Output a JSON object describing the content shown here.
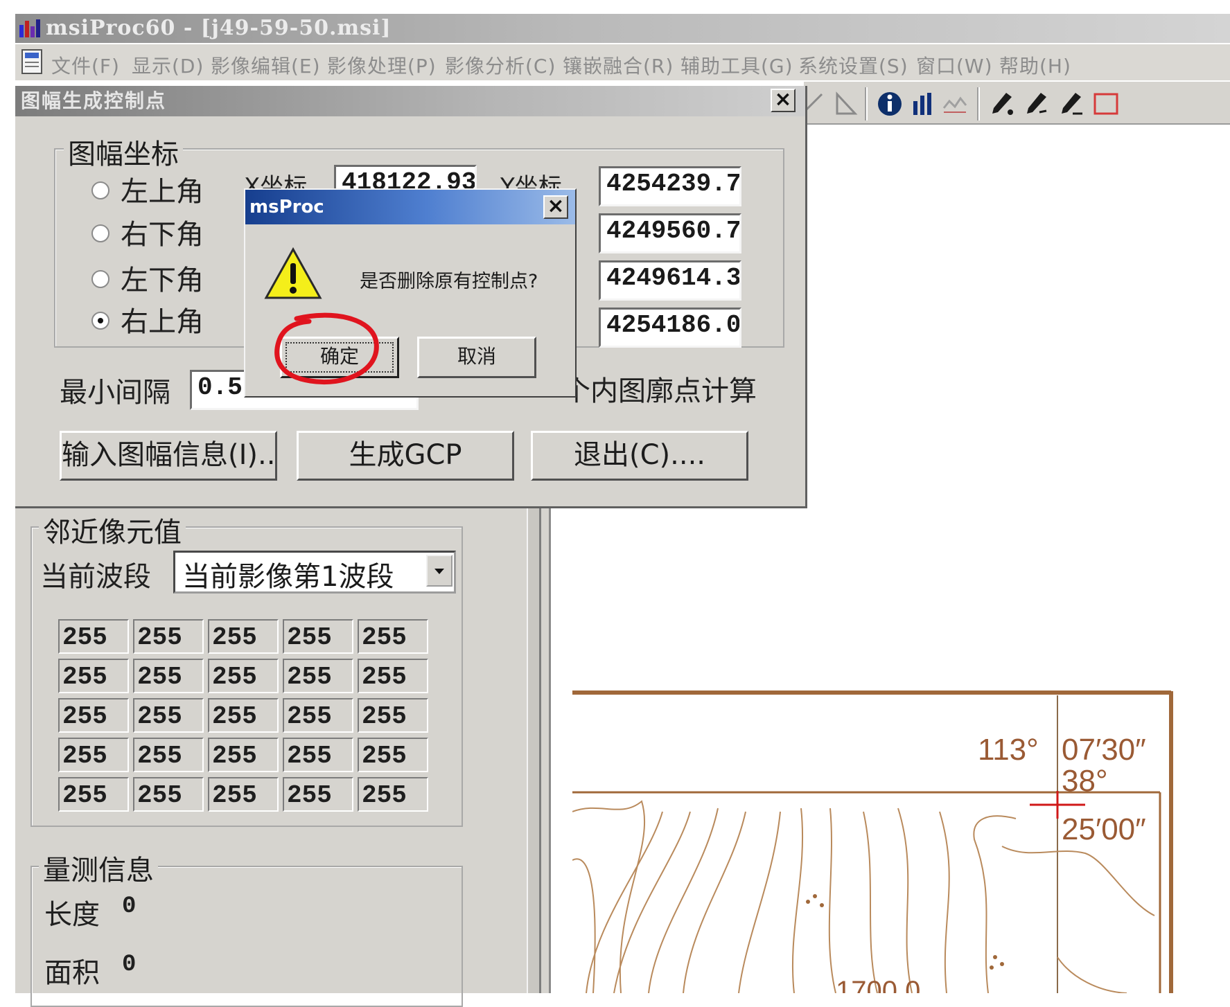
{
  "app": {
    "title": "msiProc60 - [j49-59-50.msi]"
  },
  "menubar": {
    "items": [
      "文件(F)",
      "显示(D)",
      "影像编辑(E)",
      "影像处理(P)",
      "影像分析(C)",
      "镶嵌融合(R)",
      "辅助工具(G)",
      "系统设置(S)",
      "窗口(W)",
      "帮助(H)"
    ]
  },
  "toolbar": {
    "icons": [
      "line-tool-icon",
      "triangle-tool-icon",
      "info-icon",
      "histogram-icon",
      "profile-icon",
      "pen-add-icon",
      "pen-edit-icon",
      "pen-delete-icon",
      "rectangle-icon"
    ]
  },
  "gcp_dialog": {
    "title": "图幅生成控制点",
    "close": "×",
    "group_label": "图幅坐标",
    "corners": [
      {
        "label": "左上角",
        "checked": false
      },
      {
        "label": "右下角",
        "checked": false
      },
      {
        "label": "左下角",
        "checked": false
      },
      {
        "label": "右上角",
        "checked": true
      }
    ],
    "x_label": "X坐标",
    "y_label": "Y坐标",
    "x_first_value": "418122.93",
    "y_values": [
      "4254239.7",
      "4249560.7",
      "4249614.3",
      "4254186.0"
    ],
    "min_interval_label": "最小间隔",
    "min_interval_value": "0.5",
    "interior_calc_label": "个内图廓点计算",
    "buttons": {
      "input_info": "输入图幅信息(I)..",
      "generate": "生成GCP",
      "exit": "退出(C)...."
    }
  },
  "confirm_dialog": {
    "title": "msProc",
    "close": "×",
    "message": "是否删除原有控制点?",
    "ok": "确定",
    "cancel": "取消",
    "highlight_color": "#e0141e"
  },
  "left_panel": {
    "neighbor_group": "邻近像元值",
    "band_label": "当前波段",
    "band_value": "当前影像第1波段",
    "pixel_values": [
      [
        "255",
        "255",
        "255",
        "255",
        "255"
      ],
      [
        "255",
        "255",
        "255",
        "255",
        "255"
      ],
      [
        "255",
        "255",
        "255",
        "255",
        "255"
      ],
      [
        "255",
        "255",
        "255",
        "255",
        "255"
      ],
      [
        "255",
        "255",
        "255",
        "255",
        "255"
      ]
    ],
    "measure_group": "量测信息",
    "length_label": "长度",
    "length_value": "0",
    "area_label": "面积",
    "area_value": "0"
  },
  "map": {
    "lon_label": "113°",
    "lon_min": "07′30″",
    "lat_label": "38°",
    "lat_min": "25′00″",
    "contour_label": "1700.0",
    "frame_color": "#a0683a",
    "contour_color": "#b98a5c"
  }
}
